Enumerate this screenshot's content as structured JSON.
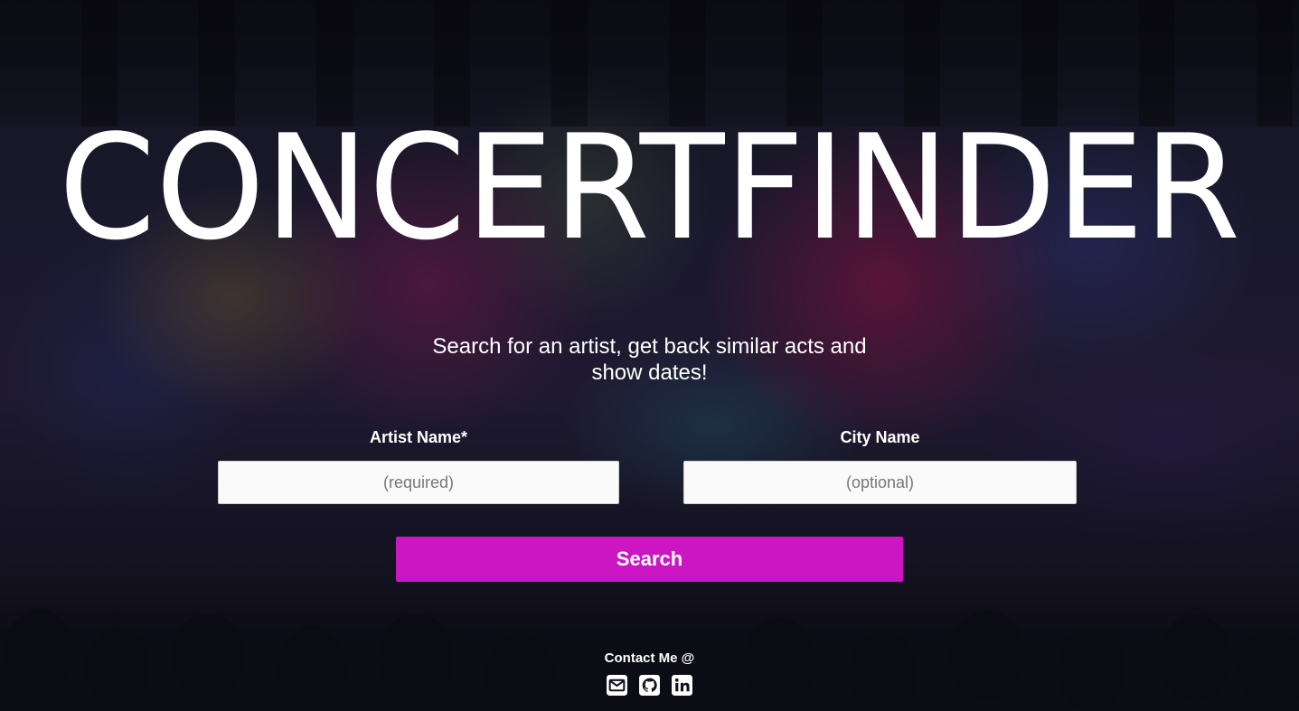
{
  "header": {
    "title": "CONCERTFINDER"
  },
  "intro": {
    "tagline": "Search for an artist, get back similar acts and show dates!"
  },
  "form": {
    "artist_label": "Artist Name*",
    "artist_placeholder": "(required)",
    "artist_value": "",
    "city_label": "City Name",
    "city_placeholder": "(optional)",
    "city_value": "",
    "search_label": "Search"
  },
  "footer": {
    "contact_label": "Contact Me @",
    "links": [
      {
        "icon": "envelope-icon"
      },
      {
        "icon": "github-icon"
      },
      {
        "icon": "linkedin-icon"
      }
    ]
  },
  "colors": {
    "accent": "#cc16c4",
    "text": "#ffffff",
    "input_bg": "#fafafa"
  }
}
